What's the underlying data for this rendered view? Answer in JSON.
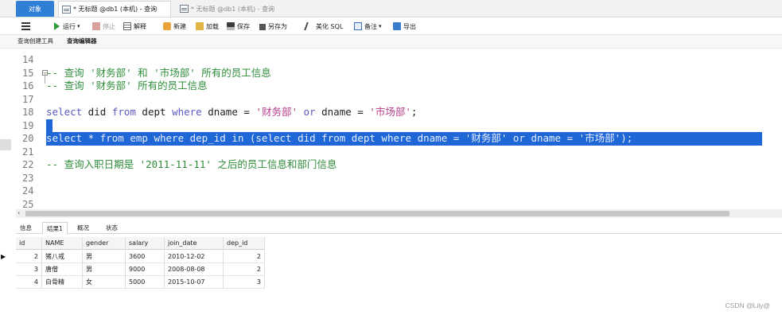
{
  "tabs": {
    "objects": "对象",
    "query_active": "* 无标题 @db1 (本机) - 查询",
    "query_inactive": "* 无标题 @db1 (本机) - 查询"
  },
  "toolbar": {
    "run": "运行",
    "stop": "停止",
    "explain": "解释",
    "new": "新建",
    "load": "加载",
    "save": "保存",
    "save_as": "另存为",
    "beautify": "美化 SQL",
    "comment": "备注",
    "export": "导出"
  },
  "subtabs": {
    "builder": "查询创建工具",
    "editor": "查询编辑器"
  },
  "editor": {
    "lines": [
      {
        "num": "14",
        "parts": []
      },
      {
        "num": "15",
        "parts": [
          {
            "t": "-- 查询 '财务部' 和 '市场部' 所有的员工信息",
            "c": "cmt"
          }
        ]
      },
      {
        "num": "16",
        "parts": [
          {
            "t": "-- 查询 '财务部' 所有的员工信息",
            "c": "cmt"
          }
        ]
      },
      {
        "num": "17",
        "parts": []
      },
      {
        "num": "18",
        "parts": [
          {
            "t": "select",
            "c": "kw"
          },
          {
            "t": " did ",
            "c": "op"
          },
          {
            "t": "from",
            "c": "kw"
          },
          {
            "t": " dept ",
            "c": "op"
          },
          {
            "t": "where",
            "c": "kw"
          },
          {
            "t": " dname = ",
            "c": "op"
          },
          {
            "t": "'财务部'",
            "c": "str"
          },
          {
            "t": " ",
            "c": "op"
          },
          {
            "t": "or",
            "c": "kw"
          },
          {
            "t": " dname = ",
            "c": "op"
          },
          {
            "t": "'市场部'",
            "c": "str"
          },
          {
            "t": ";",
            "c": "op"
          }
        ]
      },
      {
        "num": "19",
        "parts": []
      },
      {
        "num": "20",
        "parts": [
          {
            "t": "select * from emp where dep_id in (select did from dept where dname = '财务部' or dname = '市场部');",
            "c": "op"
          }
        ]
      },
      {
        "num": "21",
        "parts": []
      },
      {
        "num": "22",
        "parts": [
          {
            "t": "-- 查询入职日期是 '2011-11-11' 之后的员工信息和部门信息",
            "c": "cmt"
          }
        ]
      },
      {
        "num": "23",
        "parts": []
      },
      {
        "num": "24",
        "parts": []
      },
      {
        "num": "25",
        "parts": []
      }
    ],
    "selected_lines": [
      "19",
      "20"
    ],
    "colors": {
      "keyword": "#5a5ac0",
      "string": "#b53e8a",
      "comment": "#2f8c3a",
      "selection": "#1f66d6"
    }
  },
  "result_tabs": {
    "info": "信息",
    "result": "结果1",
    "overview": "概况",
    "status": "状态"
  },
  "results": {
    "columns": [
      "id",
      "NAME",
      "gender",
      "salary",
      "join_date",
      "dep_id"
    ],
    "rows": [
      [
        "2",
        "猪八戒",
        "男",
        "3600",
        "2010-12-02",
        "2"
      ],
      [
        "3",
        "唐僧",
        "男",
        "9000",
        "2008-08-08",
        "2"
      ],
      [
        "4",
        "白骨精",
        "女",
        "5000",
        "2015-10-07",
        "3"
      ]
    ],
    "current_row_marker": "▶"
  },
  "watermark": "CSDN @Lily@"
}
